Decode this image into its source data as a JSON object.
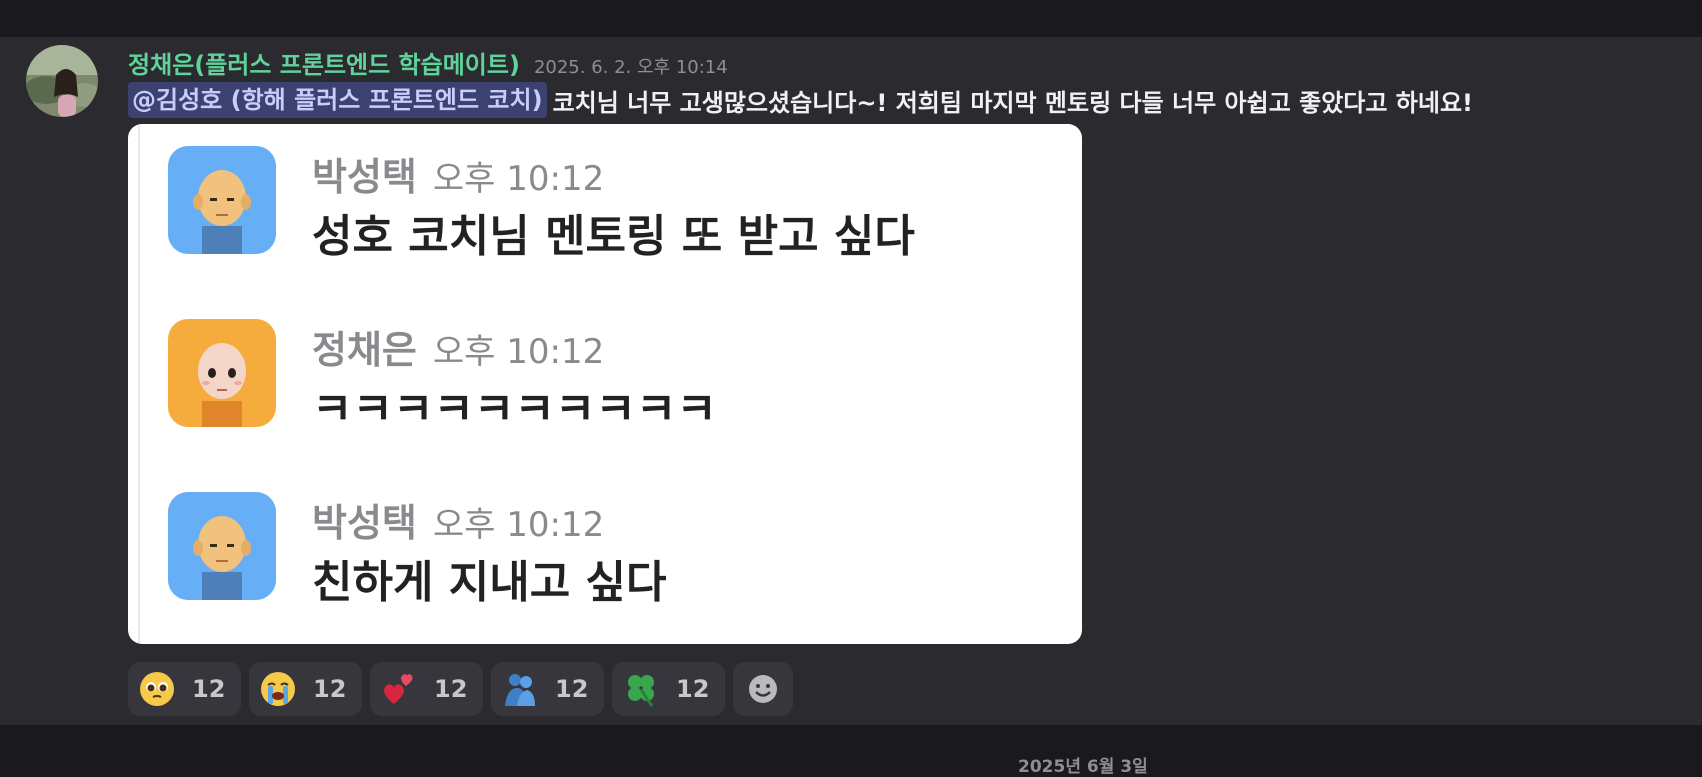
{
  "message": {
    "author": "정채은(플러스 프론트엔드 학습메이트)",
    "timestamp": "2025. 6. 2. 오후 10:14",
    "mention": "@김성호  (항해 플러스 프론트엔드 코치)",
    "text": "코치님 너무 고생많으셨습니다~! 저희팀 마지막 멘토링 다들 너무 아쉽고 좋았다고 하네요!"
  },
  "embed": {
    "messages": [
      {
        "name": "박성택",
        "time": "오후 10:12",
        "text": "성호 코치님 멘토링 또 받고 싶다",
        "avatar_bg": "#66aef5"
      },
      {
        "name": "정채은",
        "time": "오후 10:12",
        "text": "ㅋㅋㅋㅋㅋㅋㅋㅋㅋㅋ",
        "avatar_bg": "#f5ac3c"
      },
      {
        "name": "박성택",
        "time": "오후 10:12",
        "text": "친하게 지내고 싶다",
        "avatar_bg": "#66aef5"
      }
    ]
  },
  "reactions": [
    {
      "emoji": "pleading-face-emoji",
      "count": "12"
    },
    {
      "emoji": "crying-face-emoji",
      "count": "12"
    },
    {
      "emoji": "heart-exclamation-emoji",
      "count": "12"
    },
    {
      "emoji": "hugging-people-emoji",
      "count": "12"
    },
    {
      "emoji": "four-leaf-clover-emoji",
      "count": "12"
    }
  ],
  "add_reaction_icon": "add-reaction-smiley-icon",
  "date_divider": "2025년 6월 3일",
  "colors": {
    "username": "#5fd39a",
    "mention_bg": "#3c4270",
    "mention_text": "#c9cdfb",
    "background": "#2a2a2f"
  }
}
